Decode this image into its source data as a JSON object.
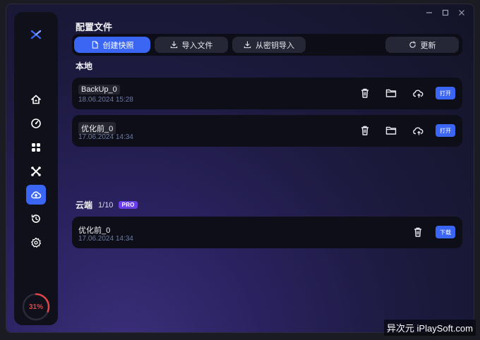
{
  "window": {
    "controls": [
      "minimize-icon",
      "maximize-icon",
      "close-icon"
    ]
  },
  "sidebar": {
    "logo": "x-logo-icon",
    "items": [
      {
        "name": "home",
        "icon": "home-icon"
      },
      {
        "name": "speed",
        "icon": "gauge-icon"
      },
      {
        "name": "apps",
        "icon": "apps-icon"
      },
      {
        "name": "tools",
        "icon": "x-tools-icon"
      },
      {
        "name": "cloud-backup",
        "icon": "cloud-upload-icon",
        "active": true
      },
      {
        "name": "history",
        "icon": "history-icon"
      },
      {
        "name": "settings",
        "icon": "gear-icon"
      }
    ],
    "cpu_percent_label": "31%",
    "cpu_percent": 0.31
  },
  "header": {
    "title": "配置文件"
  },
  "toolbar": {
    "create_snapshot": "创建快照",
    "import_file": "导入文件",
    "import_from_key": "从密钥导入",
    "refresh": "更新"
  },
  "local": {
    "title": "本地",
    "items": [
      {
        "name": "BackUp_0",
        "date": "18.06.2024 15:28",
        "open_label": "打开"
      },
      {
        "name": "优化前_0",
        "date": "17.06.2024 14:34",
        "open_label": "打开"
      }
    ]
  },
  "cloud": {
    "title": "云端",
    "count": "1/10",
    "badge": "PRO",
    "items": [
      {
        "name": "优化前_0",
        "date": "17.06.2024 14:34",
        "download_label": "下载"
      }
    ]
  },
  "watermark": "异次元 iPlaySoft.com",
  "colors": {
    "accent": "#3b66f3",
    "pro": "#6a3ee8",
    "cpu": "#e0454a"
  }
}
